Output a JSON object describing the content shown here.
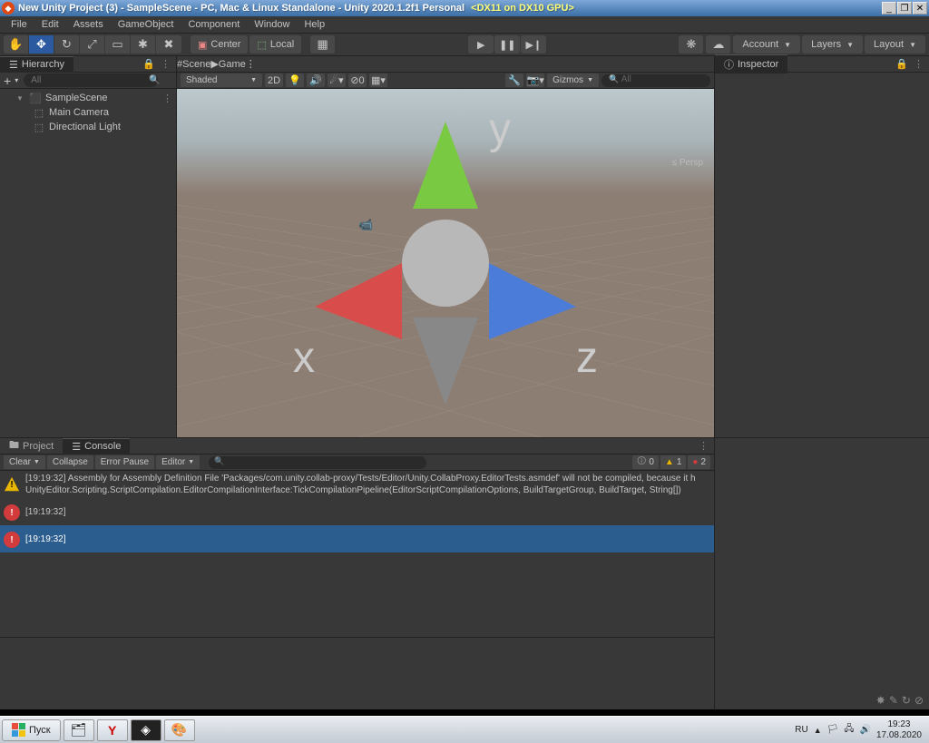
{
  "titlebar": {
    "title": "New Unity Project (3) - SampleScene - PC, Mac & Linux Standalone - Unity 2020.1.2f1 Personal",
    "dx": "<DX11 on DX10 GPU>"
  },
  "menubar": [
    "File",
    "Edit",
    "Assets",
    "GameObject",
    "Component",
    "Window",
    "Help"
  ],
  "toolbar": {
    "center": "Center",
    "local": "Local",
    "account": "Account",
    "layers": "Layers",
    "layout": "Layout"
  },
  "hierarchy": {
    "tab": "Hierarchy",
    "search_placeholder": "All",
    "root": "SampleScene",
    "items": [
      "Main Camera",
      "Directional Light"
    ]
  },
  "scene": {
    "tabs": [
      "Scene",
      "Game"
    ],
    "shading": "Shaded",
    "mode_2d": "2D",
    "gizmos": "Gizmos",
    "search_placeholder": "All",
    "persp": "≤ Persp",
    "axes": {
      "x": "x",
      "y": "y",
      "z": "z"
    }
  },
  "inspector": {
    "tab": "Inspector"
  },
  "project_console": {
    "tabs": [
      "Project",
      "Console"
    ],
    "buttons": {
      "clear": "Clear",
      "collapse": "Collapse",
      "error_pause": "Error Pause",
      "editor": "Editor"
    },
    "badges": {
      "info": "0",
      "warn": "1",
      "error": "2"
    },
    "entries": [
      {
        "type": "warn",
        "line1": "[19:19:32] Assembly for Assembly Definition File 'Packages/com.unity.collab-proxy/Tests/Editor/Unity.CollabProxy.EditorTests.asmdef' will not be compiled, because it h",
        "line2": "UnityEditor.Scripting.ScriptCompilation.EditorCompilationInterface:TickCompilationPipeline(EditorScriptCompilationOptions, BuildTargetGroup, BuildTarget, String[])"
      },
      {
        "type": "err",
        "line1": "[19:19:32]"
      },
      {
        "type": "err",
        "line1": "[19:19:32]",
        "selected": true
      }
    ]
  },
  "taskbar": {
    "start": "Пуск",
    "lang": "RU",
    "time": "19:23",
    "date": "17.08.2020"
  }
}
